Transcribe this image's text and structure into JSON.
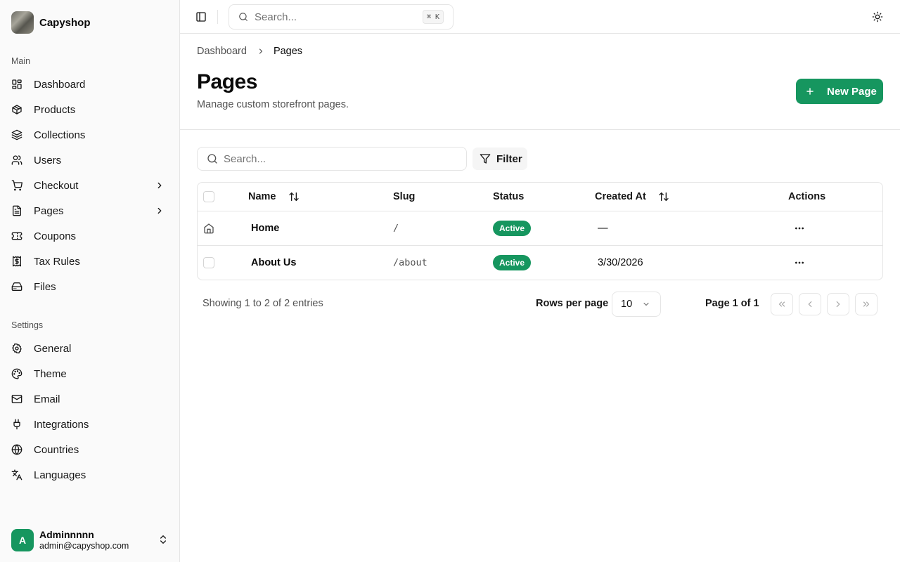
{
  "brand": {
    "name": "Capyshop"
  },
  "sidebar": {
    "main_label": "Main",
    "main_items": [
      {
        "label": "Dashboard",
        "icon": "dashboard-icon"
      },
      {
        "label": "Products",
        "icon": "package-icon"
      },
      {
        "label": "Collections",
        "icon": "layers-icon"
      },
      {
        "label": "Users",
        "icon": "users-icon"
      },
      {
        "label": "Checkout",
        "icon": "cart-icon",
        "expandable": true
      },
      {
        "label": "Pages",
        "icon": "file-icon",
        "expandable": true
      },
      {
        "label": "Coupons",
        "icon": "ticket-icon"
      },
      {
        "label": "Tax Rules",
        "icon": "receipt-icon"
      },
      {
        "label": "Files",
        "icon": "hard-drive-icon"
      }
    ],
    "settings_label": "Settings",
    "settings_items": [
      {
        "label": "General",
        "icon": "gear-icon"
      },
      {
        "label": "Theme",
        "icon": "palette-icon"
      },
      {
        "label": "Email",
        "icon": "mail-icon"
      },
      {
        "label": "Integrations",
        "icon": "plug-icon"
      },
      {
        "label": "Countries",
        "icon": "globe-icon"
      },
      {
        "label": "Languages",
        "icon": "translate-icon"
      }
    ],
    "user": {
      "initial": "A",
      "name": "Adminnnnn",
      "email": "admin@capyshop.com"
    }
  },
  "topbar": {
    "search_placeholder": "Search...",
    "shortcut": "⌘ K"
  },
  "breadcrumb": {
    "parent": "Dashboard",
    "current": "Pages"
  },
  "header": {
    "title": "Pages",
    "subtitle": "Manage custom storefront pages.",
    "new_button": "New Page"
  },
  "toolbar": {
    "search_placeholder": "Search...",
    "filter_label": "Filter"
  },
  "table": {
    "columns": {
      "name": "Name",
      "slug": "Slug",
      "status": "Status",
      "created": "Created At",
      "actions": "Actions"
    },
    "rows": [
      {
        "name": "Home",
        "slug": "/",
        "status": "Active",
        "created": "—",
        "is_home": true
      },
      {
        "name": "About Us",
        "slug": "/about",
        "status": "Active",
        "created": "3/30/2026",
        "is_home": false
      }
    ]
  },
  "pagination": {
    "showing": "Showing 1 to 2 of 2 entries",
    "rows_per_page_label": "Rows per page",
    "rows_per_page": "10",
    "page_info": "Page 1 of 1"
  },
  "colors": {
    "accent": "#16965f",
    "border": "#e5e5e5",
    "muted": "#525252"
  }
}
